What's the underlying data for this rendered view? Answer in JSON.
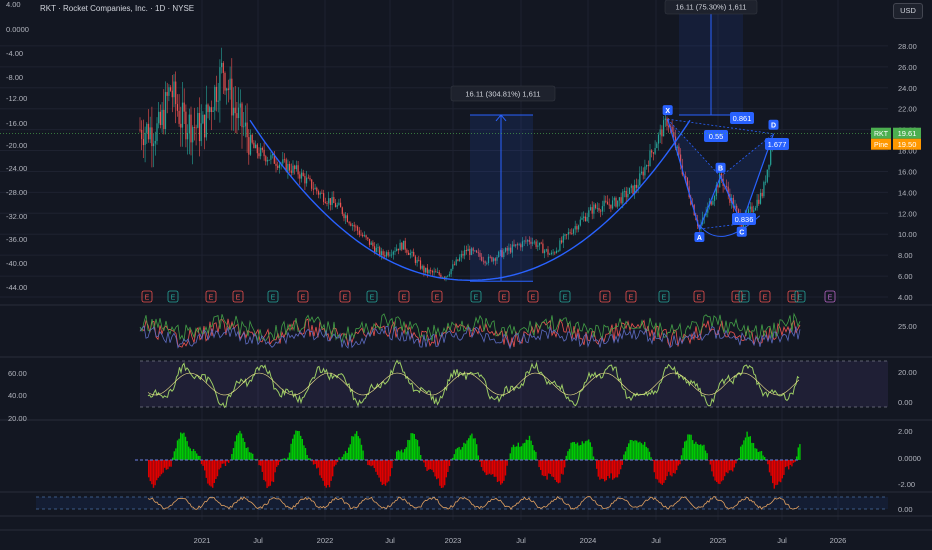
{
  "header": {
    "symbol_title": "RKT · Rocket Companies, Inc. · 1D · NYSE",
    "currency": "USD"
  },
  "colors": {
    "background": "#131722",
    "grid": "#1e2230",
    "pattern_blue": "#2962ff",
    "candle_up": "#26a69a",
    "candle_down": "#ef5350",
    "hist_up": "#00c805",
    "hist_down": "#e00000",
    "rsi_line": "#9ccc65",
    "stoch_line": "#e0a060",
    "price_label": "#4caf50",
    "pine_label": "#ff9800"
  },
  "chart_data": {
    "type": "candlestick",
    "title": "RKT · Rocket Companies, Inc. · 1D · NYSE",
    "x_labels": [
      "2021",
      "Jul",
      "2022",
      "Jul",
      "2023",
      "Jul",
      "2024",
      "Jul",
      "2025",
      "Jul",
      "2026"
    ],
    "y_right_ticks": [
      "28.00",
      "26.00",
      "24.00",
      "22.00",
      "20.00",
      "18.00",
      "16.00",
      "14.00",
      "12.00",
      "10.00",
      "8.00",
      "6.00",
      "4.00"
    ],
    "y_right_range": [
      4,
      30
    ],
    "y_left_ticks": [
      "4.00",
      "0.0000",
      "-4.00",
      "-8.00",
      "-12.00",
      "-16.00",
      "-20.00",
      "-24.00",
      "-28.00",
      "-32.00",
      "-36.00",
      "-40.00",
      "-44.00"
    ],
    "price_path": [
      {
        "x": "2020-09",
        "y": 20
      },
      {
        "x": "2020-10",
        "y": 24
      },
      {
        "x": "2020-11",
        "y": 21
      },
      {
        "x": "2021-01",
        "y": 20
      },
      {
        "x": "2021-03",
        "y": 26
      },
      {
        "x": "2021-04",
        "y": 22
      },
      {
        "x": "2021-06",
        "y": 18
      },
      {
        "x": "2021-08",
        "y": 17
      },
      {
        "x": "2021-10",
        "y": 16
      },
      {
        "x": "2021-12",
        "y": 14
      },
      {
        "x": "2022-02",
        "y": 12.5
      },
      {
        "x": "2022-04",
        "y": 10
      },
      {
        "x": "2022-06",
        "y": 8
      },
      {
        "x": "2022-08",
        "y": 9
      },
      {
        "x": "2022-10",
        "y": 6.5
      },
      {
        "x": "2022-12",
        "y": 6
      },
      {
        "x": "2023-02",
        "y": 8.5
      },
      {
        "x": "2023-04",
        "y": 7.5
      },
      {
        "x": "2023-06",
        "y": 8.5
      },
      {
        "x": "2023-08",
        "y": 9.5
      },
      {
        "x": "2023-10",
        "y": 8
      },
      {
        "x": "2023-12",
        "y": 10.5
      },
      {
        "x": "2024-02",
        "y": 12.5
      },
      {
        "x": "2024-04",
        "y": 13
      },
      {
        "x": "2024-06",
        "y": 14.5
      },
      {
        "x": "2024-08",
        "y": 19
      },
      {
        "x": "2024-09",
        "y": 21
      },
      {
        "x": "2024-11",
        "y": 14
      },
      {
        "x": "2024-12",
        "y": 10.5
      },
      {
        "x": "2025-02",
        "y": 15.5
      },
      {
        "x": "2025-04",
        "y": 11
      },
      {
        "x": "2025-06",
        "y": 14
      },
      {
        "x": "2025-07",
        "y": 19.6
      }
    ],
    "harmonic_pattern": {
      "points": [
        {
          "label": "X",
          "x": "2024-09",
          "y": 21
        },
        {
          "label": "A",
          "x": "2024-12",
          "y": 10.5
        },
        {
          "label": "B",
          "x": "2025-02",
          "y": 15.5
        },
        {
          "label": "C",
          "x": "2025-04",
          "y": 11
        },
        {
          "label": "D",
          "x": "2025-07",
          "y": 19.6
        }
      ],
      "ratios": [
        "0.55",
        "0.861",
        "1.677",
        "0.836"
      ]
    },
    "measurements": [
      {
        "label": "16.11 (304.81%) 1,611",
        "from": 5.5,
        "to": 21.4
      },
      {
        "label": "16.11 (75.30%) 1,611",
        "from": 21.4,
        "to": 37
      }
    ],
    "last_price": {
      "symbol": "RKT",
      "value": "19.61"
    },
    "pine_value": {
      "symbol": "Pine",
      "value": "19.50"
    },
    "events": [
      "E",
      "E",
      "E",
      "E",
      "E",
      "E",
      "E",
      "E",
      "E",
      "E",
      "E",
      "E",
      "E",
      "E",
      "E",
      "E",
      "E",
      "E",
      "E",
      "E",
      "E",
      "E",
      "E",
      "E"
    ],
    "panes": [
      {
        "name": "",
        "right_ticks": [
          "25.00"
        ],
        "left_ticks": []
      },
      {
        "name": "",
        "right_ticks": [
          "20.00",
          "0.00"
        ],
        "left_ticks": [
          "60.00",
          "40.00",
          "20.00"
        ]
      },
      {
        "name": "",
        "right_ticks": [
          "2.00",
          "0.0000",
          "-2.00"
        ],
        "left_ticks": []
      },
      {
        "name": "",
        "right_ticks": [
          "0.00"
        ],
        "left_ticks": []
      }
    ]
  }
}
